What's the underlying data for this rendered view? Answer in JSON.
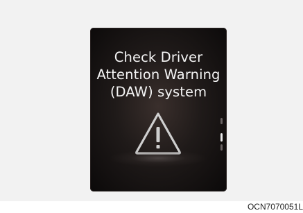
{
  "display": {
    "message_lines": [
      "Check Driver",
      "Attention Warning",
      "(DAW) system"
    ],
    "icon": "warning-triangle-icon",
    "colors": {
      "screen_background": "#0b0909",
      "text": "#f4f4f4",
      "icon": "#cfcfcf"
    }
  },
  "figure_code": "OCN7070051L"
}
